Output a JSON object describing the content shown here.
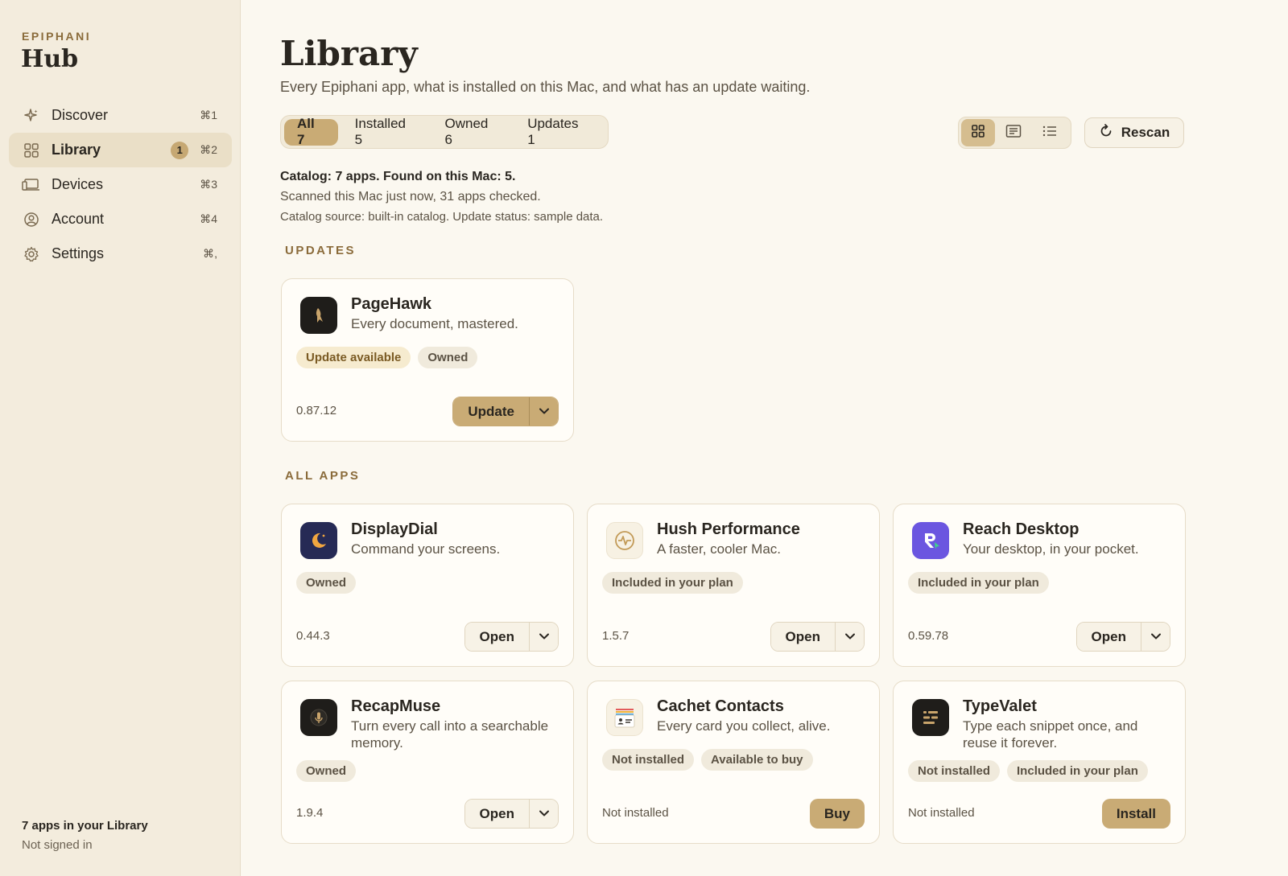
{
  "sidebar": {
    "brand_small": "EPIPHANI",
    "brand_big": "Hub",
    "items": [
      {
        "label": "Discover",
        "shortcut": "⌘1",
        "icon": "sparkle-icon"
      },
      {
        "label": "Library",
        "shortcut": "⌘2",
        "icon": "grid-icon",
        "badge": "1",
        "active": true
      },
      {
        "label": "Devices",
        "shortcut": "⌘3",
        "icon": "devices-icon"
      },
      {
        "label": "Account",
        "shortcut": "⌘4",
        "icon": "person-circle-icon"
      },
      {
        "label": "Settings",
        "shortcut": "⌘,",
        "icon": "gear-icon"
      }
    ],
    "footer_count": "7 apps in your Library",
    "footer_status": "Not signed in"
  },
  "header": {
    "title": "Library",
    "subtitle": "Every Epiphani app, what is installed on this Mac, and what has an update waiting."
  },
  "filters": [
    {
      "label": "All 7",
      "active": true
    },
    {
      "label": "Installed 5"
    },
    {
      "label": "Owned 6"
    },
    {
      "label": "Updates 1"
    }
  ],
  "view_modes": [
    "grid-view-icon",
    "card-view-icon",
    "list-view-icon"
  ],
  "rescan_label": "Rescan",
  "catalog": {
    "summary": "Catalog: 7 apps. Found on this Mac: 5.",
    "scan": "Scanned this Mac just now, 31 apps checked.",
    "source": "Catalog source: built-in catalog. Update status: sample data."
  },
  "sections": {
    "updates": "UPDATES",
    "all_apps": "ALL APPS"
  },
  "update_apps": [
    {
      "name": "PageHawk",
      "tagline": "Every document, mastered.",
      "tags": [
        "Update available",
        "Owned"
      ],
      "version": "0.87.12",
      "action": "Update"
    }
  ],
  "apps": [
    {
      "name": "DisplayDial",
      "tagline": "Command your screens.",
      "tags": [
        "Owned"
      ],
      "version": "0.44.3",
      "action": "Open"
    },
    {
      "name": "Hush Performance",
      "tagline": "A faster, cooler Mac.",
      "tags": [
        "Included in your plan"
      ],
      "version": "1.5.7",
      "action": "Open"
    },
    {
      "name": "Reach Desktop",
      "tagline": "Your desktop, in your pocket.",
      "tags": [
        "Included in your plan"
      ],
      "version": "0.59.78",
      "action": "Open"
    },
    {
      "name": "RecapMuse",
      "tagline": "Turn every call into a searchable memory.",
      "tags": [
        "Owned"
      ],
      "version": "1.9.4",
      "action": "Open"
    },
    {
      "name": "Cachet Contacts",
      "tagline": "Every card you collect, alive.",
      "tags": [
        "Not installed",
        "Available to buy"
      ],
      "version": "Not installed",
      "action": "Buy"
    },
    {
      "name": "TypeValet",
      "tagline": "Type each snippet once, and reuse it forever.",
      "tags": [
        "Not installed",
        "Included in your plan"
      ],
      "version": "Not installed",
      "action": "Install"
    }
  ],
  "colors": {
    "accent": "#c9ab75",
    "sidebar_bg": "#f3ecdd",
    "page_bg": "#fbf8f0",
    "section_label": "#8a6b3a"
  }
}
